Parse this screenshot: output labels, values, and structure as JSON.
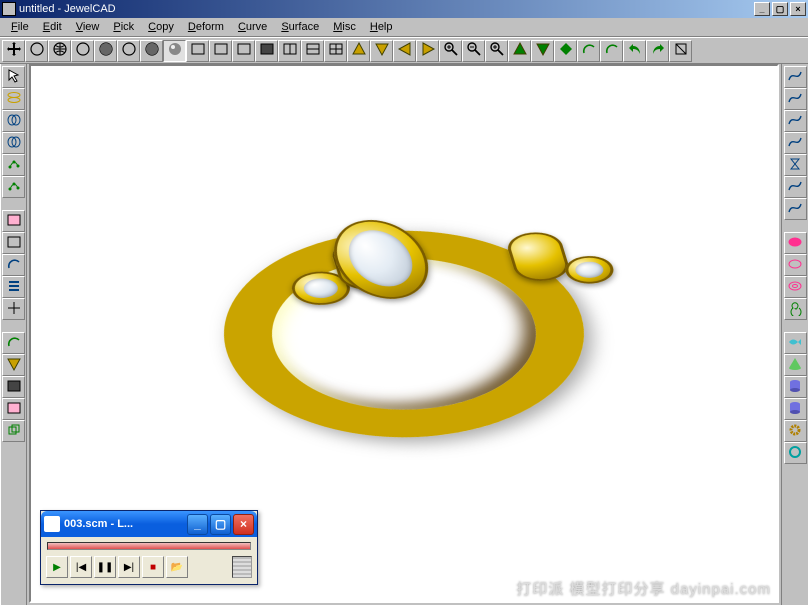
{
  "title": "untitled - JewelCAD",
  "menus": [
    "File",
    "Edit",
    "View",
    "Pick",
    "Copy",
    "Deform",
    "Curve",
    "Surface",
    "Misc",
    "Help"
  ],
  "toolbar_top": [
    "move",
    "circle-select",
    "globe",
    "sphere-wire",
    "sphere-shade",
    "sphere-half",
    "sphere-solid",
    "render",
    "rect-outline",
    "rect-half-l",
    "rect-half-r",
    "rect-solid",
    "split-v",
    "split-h",
    "split-4",
    "tri-up-y",
    "tri-dn-y",
    "tri-lt-y",
    "tri-rt-y",
    "zoom-in",
    "zoom-out",
    "zoom-window",
    "tri-up-g",
    "tri-dn-g",
    "diamond-g",
    "arc-ccw",
    "arc-cw",
    "undo",
    "redo",
    "wire-toggle"
  ],
  "toolbar_left": [
    "select-arrow",
    "ellipses",
    "rings-blue",
    "rings-stack",
    "dots-green",
    "dots-curve",
    "|gap|",
    "rect-pink",
    "rect-blue",
    "arc-blue",
    "bars",
    "cross",
    "|gap|",
    "arc-open",
    "tri-dn",
    "rect-solid-pk",
    "rect-outline-pk",
    "dup-green"
  ],
  "toolbar_right": [
    "curve-s",
    "curve-rev",
    "wave",
    "loop",
    "hourglass",
    "curve-z",
    "mirror-v",
    "|gap|",
    "ellipse-solid",
    "ellipse-outline",
    "torus",
    "spiral",
    "|gap|",
    "fish",
    "cone",
    "cyl-v",
    "cyl-h",
    "gear",
    "ring-4"
  ],
  "player": {
    "title": "003.scm - L...",
    "buttons": [
      "play",
      "step-back",
      "pause",
      "step-fwd",
      "stop",
      "open"
    ]
  },
  "watermark": "打印派 模型打印分享 dayinpai.com"
}
